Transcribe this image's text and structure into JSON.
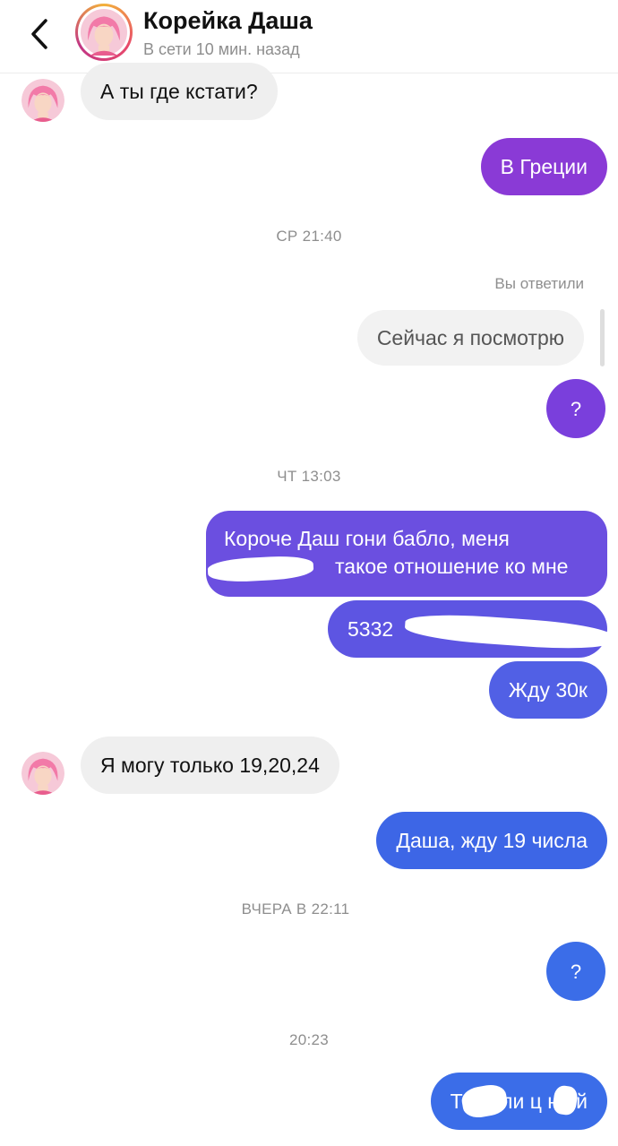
{
  "header": {
    "back_icon": "chevron-left-icon",
    "title": "Корейка Даша",
    "status": "В сети 10 мин. назад"
  },
  "messages": {
    "m1": "А ты где кстати?",
    "m2": "В Греции",
    "ts1": "СР 21:40",
    "reply_meta": "Вы ответили",
    "reply_quote": "Сейчас я посмотрю",
    "m3": "?",
    "ts2": "ЧТ 13:03",
    "m4_line1": "Короче Даш гони бабло, меня",
    "m4_line2": "такое отношение ко мне",
    "m5": "5332",
    "m6": "Жду 30к",
    "m7": "Я могу только 19,20,24",
    "m8": "Даша, жду 19 числа",
    "ts3": "ВЧЕРА В 22:11",
    "m9": "?",
    "ts4": "20:23",
    "m10": "Тебе пи      ц на  й"
  },
  "colors": {
    "purple": "#8a3ad6",
    "violet": "#6b4fe0",
    "blue": "#3b6de8",
    "incoming": "#efefef"
  }
}
